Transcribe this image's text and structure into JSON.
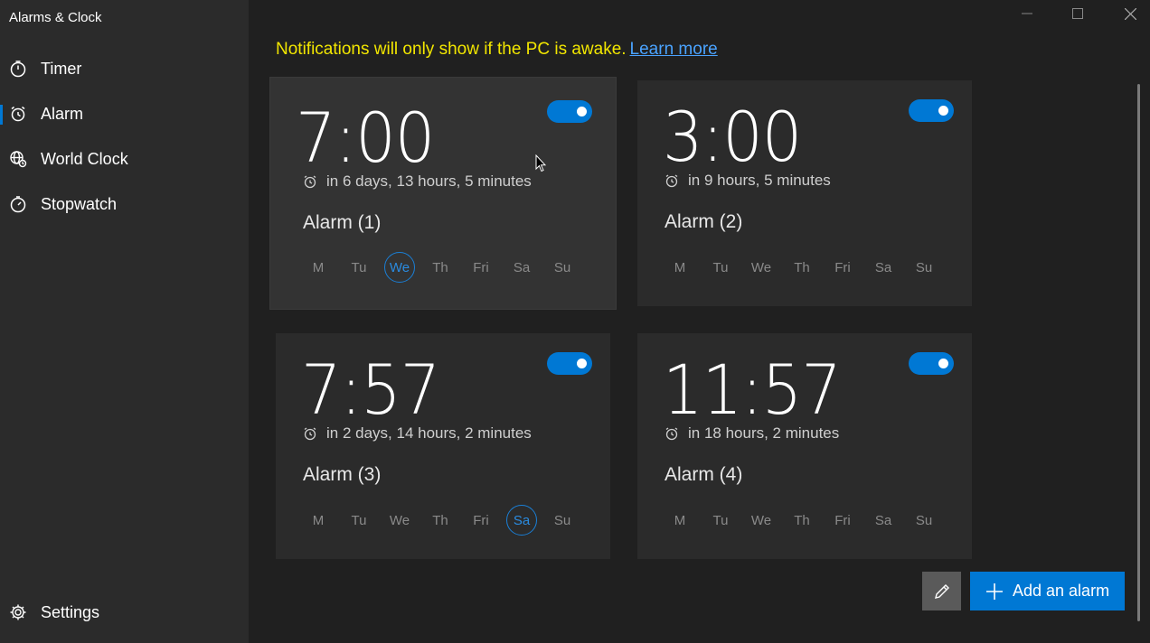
{
  "app": {
    "title": "Alarms & Clock"
  },
  "sidebar": {
    "items": [
      {
        "label": "Timer",
        "icon": "timer-icon",
        "active": false
      },
      {
        "label": "Alarm",
        "icon": "alarm-icon",
        "active": true
      },
      {
        "label": "World Clock",
        "icon": "world-clock-icon",
        "active": false
      },
      {
        "label": "Stopwatch",
        "icon": "stopwatch-icon",
        "active": false
      }
    ],
    "settings_label": "Settings"
  },
  "notice": {
    "text": "Notifications will only show if the PC is awake.",
    "link": "Learn more"
  },
  "days": [
    "M",
    "Tu",
    "We",
    "Th",
    "Fri",
    "Sa",
    "Su"
  ],
  "alarms": [
    {
      "time": "7:00",
      "remaining": "in 6 days, 13 hours, 5 minutes",
      "name": "Alarm (1)",
      "enabled": true,
      "active_day": "We"
    },
    {
      "time": "3:00",
      "remaining": "in 9 hours, 5 minutes",
      "name": "Alarm (2)",
      "enabled": true,
      "active_day": ""
    },
    {
      "time": "7:57",
      "remaining": "in 2 days, 14 hours, 2 minutes",
      "name": "Alarm (3)",
      "enabled": true,
      "active_day": "Sa"
    },
    {
      "time": "11:57",
      "remaining": "in 18 hours, 2 minutes",
      "name": "Alarm (4)",
      "enabled": true,
      "active_day": ""
    }
  ],
  "buttons": {
    "add_label": "Add an alarm"
  },
  "colors": {
    "accent": "#0078d4",
    "notice": "#f2e600",
    "link": "#4aa3ff"
  }
}
